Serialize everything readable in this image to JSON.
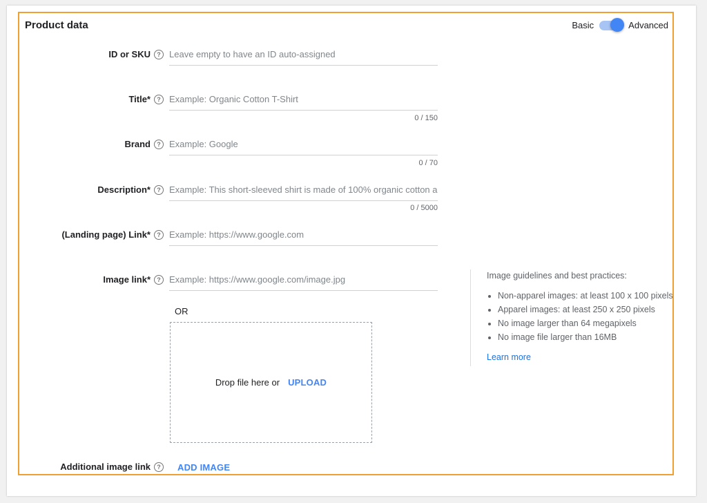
{
  "panel": {
    "title": "Product data",
    "toggle": {
      "left_label": "Basic",
      "right_label": "Advanced",
      "state": "Advanced"
    }
  },
  "fields": {
    "id_sku": {
      "label": "ID or SKU",
      "placeholder": "Leave empty to have an ID auto-assigned"
    },
    "title": {
      "label": "Title*",
      "placeholder": "Example: Organic Cotton T-Shirt",
      "counter": "0 / 150"
    },
    "brand": {
      "label": "Brand",
      "placeholder": "Example: Google",
      "counter": "0 / 70"
    },
    "description": {
      "label": "Description*",
      "placeholder": "Example: This short-sleeved shirt is made of 100% organic cotton a...",
      "counter": "0 / 5000"
    },
    "link": {
      "label": "(Landing page) Link*",
      "placeholder": "Example: https://www.google.com"
    },
    "image_link": {
      "label": "Image link*",
      "placeholder": "Example: https://www.google.com/image.jpg"
    },
    "additional_image": {
      "label": "Additional image link",
      "add_label": "ADD IMAGE"
    }
  },
  "upload": {
    "or_text": "OR",
    "drop_text": "Drop file here or",
    "upload_label": "UPLOAD"
  },
  "guidelines": {
    "title": "Image guidelines and best practices:",
    "items": [
      "Non-apparel images: at least 100 x 100 pixels",
      "Apparel images: at least 250 x 250 pixels",
      "No image larger than 64 megapixels",
      "No image file larger than 16MB"
    ],
    "learn_more": "Learn more"
  },
  "help_glyph": "?",
  "colors": {
    "accent": "#4285f4",
    "highlight_border": "#f0a030",
    "toggle_track": "#a8c4f4"
  }
}
